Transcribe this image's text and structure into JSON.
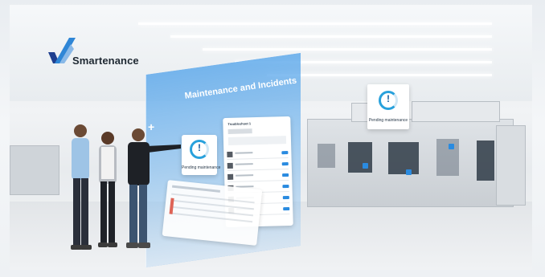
{
  "brand": {
    "name": "Smartenance",
    "logo_colors": [
      "#1f3f8f",
      "#2f86d6",
      "#8ab9e8"
    ]
  },
  "hologram": {
    "title": "Maintenance and Incidents",
    "status_card_label": "Pending maintenance",
    "status_card_icon": "exclamation-ring-icon",
    "list_header": "Troubleshoot 1"
  },
  "machine_sign": {
    "label": "Pending maintenance",
    "icon": "exclamation-ring-icon"
  },
  "colors": {
    "accent": "#2a8be0",
    "hologram": "#5fa9ea",
    "ring": "#28a1dc"
  }
}
